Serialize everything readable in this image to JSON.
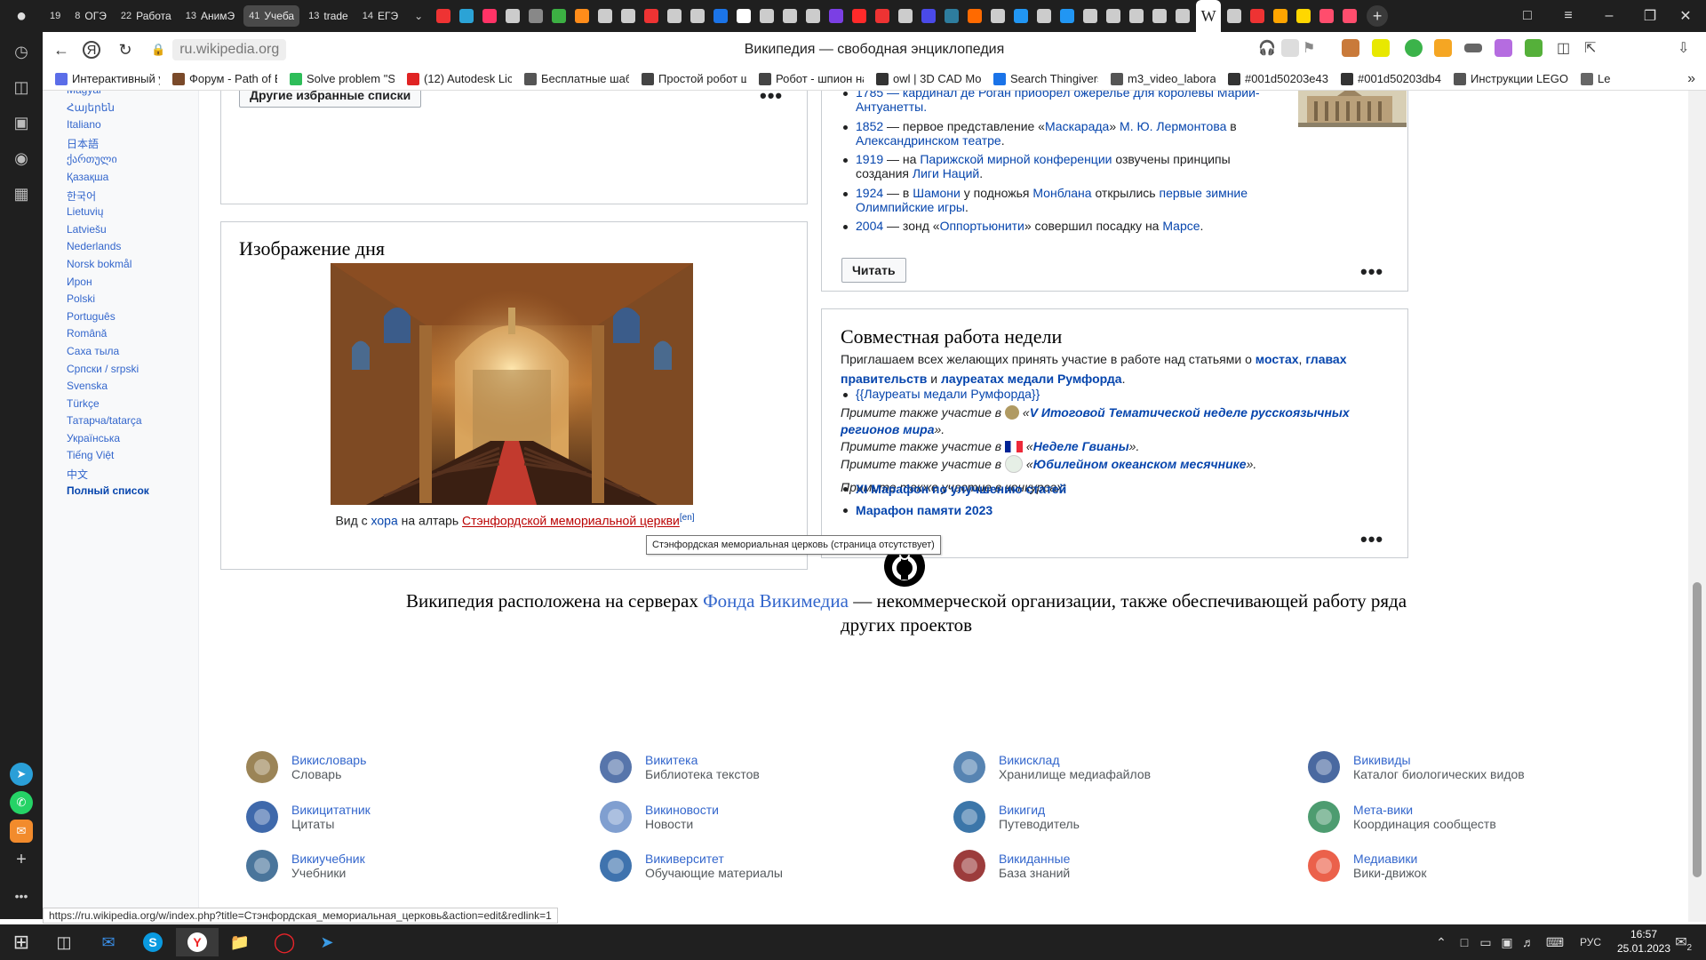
{
  "tabbar": {
    "groups": [
      {
        "count": "19",
        "label": ""
      },
      {
        "count": "8",
        "label": "ОГЭ"
      },
      {
        "count": "22",
        "label": "Работа"
      },
      {
        "count": "13",
        "label": "АнимЭ"
      },
      {
        "count": "41",
        "label": "Учеба"
      },
      {
        "count": "13",
        "label": "trade"
      },
      {
        "count": "14",
        "label": "ЕГЭ"
      }
    ]
  },
  "address": {
    "url": "ru.wikipedia.org",
    "page_title": "Википедия — свободная энциклопедия"
  },
  "bookmarks": [
    "Интерактивный у",
    "Форум - Path of E",
    "Solve problem \"Sa",
    "(12) Autodesk Lice",
    "Бесплатные шабл",
    "Простой робот ш",
    "Робот - шпион на",
    "owl | 3D CAD Mod",
    "Search Thingiverse",
    "m3_video_laborat",
    "#001d50203e43",
    "#001d50203db4",
    "Инструкции LEGO",
    "Le"
  ],
  "languages": [
    "Magyar",
    "Հայերեն",
    "Italiano",
    "日本語",
    "ქართული",
    "Қазақша",
    "한국어",
    "Lietuvių",
    "Latviešu",
    "Nederlands",
    "Norsk bokmål",
    "Ирон",
    "Polski",
    "Português",
    "Română",
    "Саха тыла",
    "Српски / srpski",
    "Svenska",
    "Türkçe",
    "Татарча/tatarça",
    "Українська",
    "Tiếng Việt",
    "中文",
    "Полный список"
  ],
  "featured_lists": {
    "button": "Другие избранные списки",
    "more": "•••"
  },
  "image_of_day": {
    "title": "Изображение дня",
    "caption_prefix": "Вид с ",
    "caption_link1": "хора",
    "caption_mid": " на алтарь ",
    "caption_red": "Стэнфордской мемориальной церкви",
    "caption_sup": "[en]",
    "more": "•••"
  },
  "events": {
    "items": [
      {
        "year": "1785",
        "text": " — кардинал де Роган приобрёл ожерелье для королевы Марии-Антуанетты."
      },
      {
        "year": "1852",
        "pre": " — первое представление «",
        "l1": "Маскарада",
        "m1": "» ",
        "l2": "М. Ю. Лермонтова",
        "m2": " в ",
        "l3": "Александринском театре",
        "post": "."
      },
      {
        "year": "1919",
        "pre": " — на ",
        "l1": "Парижской мирной конференции",
        "m1": " озвучены принципы создания ",
        "l2": "Лиги Наций",
        "post": "."
      },
      {
        "year": "1924",
        "pre": " — в ",
        "l1": "Шамони",
        "m1": " у подножья ",
        "l2": "Монблана",
        "m2": " открылись ",
        "l3": "первые зимние Олимпийские игры",
        "post": "."
      },
      {
        "year": "2004",
        "pre": " — зонд «",
        "l1": "Оппортьюнити",
        "m1": "» совершил посадку на ",
        "l2": "Марсе",
        "post": "."
      }
    ],
    "button": "Читать",
    "more": "•••"
  },
  "collab": {
    "title": "Совместная работа недели",
    "intro": "Приглашаем всех желающих принять участие в работе над статьями о ",
    "link1": "мостах",
    "sep1": ", ",
    "link2": "главах правительств",
    "sep2": " и",
    "link3": "лауреатах медали Румфорда",
    "end": ".",
    "template": "{{Лауреаты медали Румфорда}}",
    "also_prefix": "Примите также участие в",
    "also1": "V Итоговой Тематической неделе русскоязычных регионов мира",
    "also2": "Неделе Гвианы",
    "also3": "Юбилейном океанском месячнике",
    "contests_label": "Примите также участие в конкурсах:",
    "contest1": "XI Марафон по улучшению статей",
    "contest2": "Марафон памяти 2023",
    "more": "•••"
  },
  "footer": {
    "text_pre": "Википедия расположена на серверах ",
    "text_link": "Фонда Викимедиа",
    "text_post": " — некоммерческой организации, также обеспечивающей работу ряда других проектов"
  },
  "projects": [
    {
      "name": "Викисловарь",
      "desc": "Словарь"
    },
    {
      "name": "Викитека",
      "desc": "Библиотека текстов"
    },
    {
      "name": "Викисклад",
      "desc": "Хранилище медиафайлов"
    },
    {
      "name": "Викивиды",
      "desc": "Каталог биологических видов"
    },
    {
      "name": "Викицитатник",
      "desc": "Цитаты"
    },
    {
      "name": "Викиновости",
      "desc": "Новости"
    },
    {
      "name": "Викигид",
      "desc": "Путеводитель"
    },
    {
      "name": "Мета-вики",
      "desc": "Координация сообществ"
    },
    {
      "name": "Викиучебник",
      "desc": "Учебники"
    },
    {
      "name": "Викиверситет",
      "desc": "Обучающие материалы"
    },
    {
      "name": "Викиданные",
      "desc": "База знаний"
    },
    {
      "name": "Медиавики",
      "desc": "Вики-движок"
    }
  ],
  "tooltip": "Стэнфордская мемориальная церковь (страница отсутствует)",
  "status_url": "https://ru.wikipedia.org/w/index.php?title=Стэнфордская_мемориальная_церковь&action=edit&redlink=1",
  "taskbar": {
    "lang": "РУС",
    "time": "16:57",
    "date": "25.01.2023",
    "notif": "2"
  }
}
